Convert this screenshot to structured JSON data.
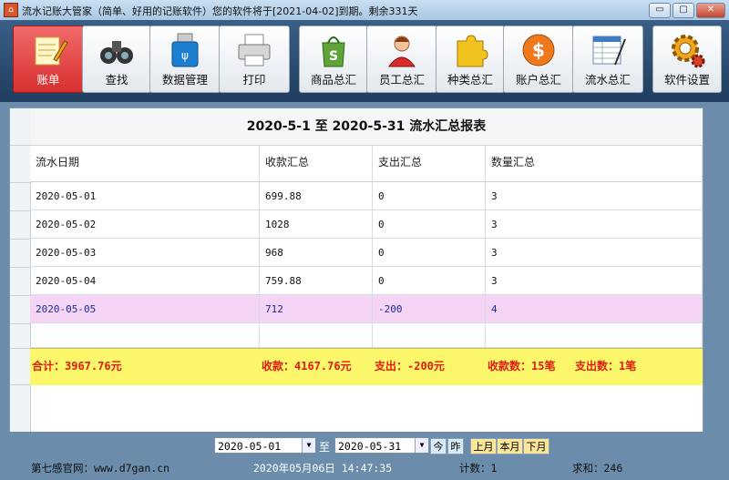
{
  "window": {
    "title": "流水记账大管家（简单、好用的记账软件）您的软件将于[2021-04-02]到期。剩余331天",
    "controls": [
      "▭",
      "▢",
      "✕"
    ]
  },
  "toolbar": {
    "items": [
      {
        "label": "账单",
        "icon": "notepad-pencil-icon",
        "active": true
      },
      {
        "label": "查找",
        "icon": "binoculars-icon"
      },
      {
        "label": "数据管理",
        "icon": "usb-drive-icon"
      },
      {
        "label": "打印",
        "icon": "printer-icon"
      },
      {
        "label": "商品总汇",
        "icon": "shopping-bag-icon"
      },
      {
        "label": "员工总汇",
        "icon": "person-icon"
      },
      {
        "label": "种类总汇",
        "icon": "puzzle-icon"
      },
      {
        "label": "账户总汇",
        "icon": "dollar-coin-icon"
      },
      {
        "label": "流水总汇",
        "icon": "spreadsheet-icon"
      },
      {
        "label": "软件设置",
        "icon": "gear-icon"
      }
    ]
  },
  "report": {
    "title": "2020-5-1 至 2020-5-31 流水汇总报表",
    "columns": [
      "流水日期",
      "收款汇总",
      "支出汇总",
      "数量汇总"
    ],
    "rows": [
      [
        "2020-05-01",
        "699.88",
        "0",
        "3"
      ],
      [
        "2020-05-02",
        "1028",
        "0",
        "3"
      ],
      [
        "2020-05-03",
        "968",
        "0",
        "3"
      ],
      [
        "2020-05-04",
        "759.88",
        "0",
        "3"
      ],
      [
        "2020-05-05",
        "712",
        "-200",
        "4"
      ]
    ],
    "selected_row": 4,
    "totals": {
      "total": "合计：3967.76元",
      "income": "收款：4167.76元",
      "expense": "支出：-200元",
      "count": "收款数：15笔",
      "expense_count": "支出数：1笔"
    }
  },
  "filter": {
    "start_date": "2020-05-01",
    "to_label": "至",
    "end_date": "2020-05-31",
    "today": "今",
    "yesterday": "昨",
    "last_month": "上月",
    "this_month": "本月",
    "next_month": "下月"
  },
  "status": {
    "website": "第七感官网：www.d7gan.cn",
    "datetime": "2020年05月06日 14:47:35",
    "count": "计数：1",
    "sum": "求和：246"
  },
  "colors": {
    "toolbar_bg": "#2a4b70",
    "active_tab": "#e03a3a",
    "totals_bg": "#fcf66a",
    "totals_text": "#e01b10",
    "selected_row": "#f6d4f6"
  }
}
